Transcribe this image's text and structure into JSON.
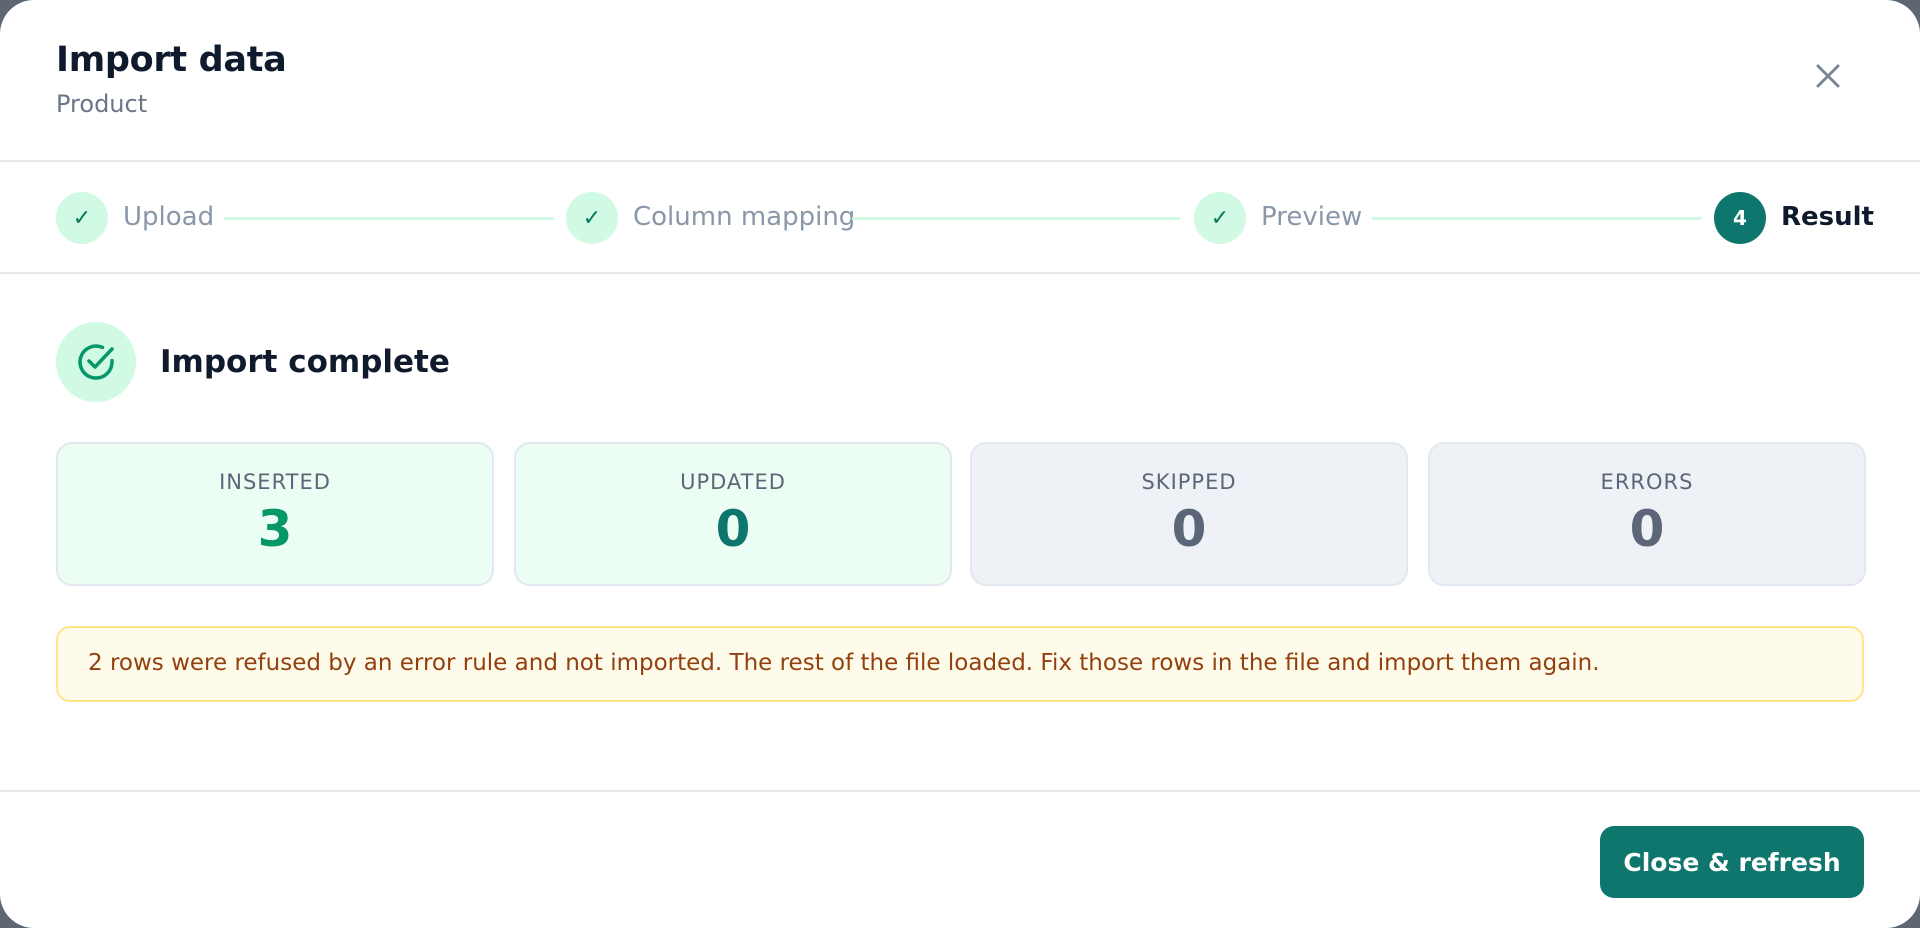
{
  "dialog": {
    "title": "Import data",
    "subtitle": "Product",
    "close_icon": "close-icon"
  },
  "steps": [
    {
      "label": "Upload",
      "state": "done",
      "marker": "✓"
    },
    {
      "label": "Column mapping",
      "state": "done",
      "marker": "✓"
    },
    {
      "label": "Preview",
      "state": "done",
      "marker": "✓"
    },
    {
      "label": "Result",
      "state": "active",
      "marker": "4"
    }
  ],
  "status": {
    "icon": "check-circle-icon",
    "text": "Import complete"
  },
  "stats": [
    {
      "label": "INSERTED",
      "value": "3",
      "color": "#059669"
    },
    {
      "label": "UPDATED",
      "value": "0",
      "color": "#0f766e"
    },
    {
      "label": "SKIPPED",
      "value": "0",
      "color": "#5b6779"
    },
    {
      "label": "ERRORS",
      "value": "0",
      "color": "#5b6779"
    }
  ],
  "notice": {
    "text": "2 rows were refused by an error rule and not imported. The rest of the file loaded. Fix those rows in the file and import them again."
  },
  "footer": {
    "close_refresh_label": "Close & refresh"
  },
  "colors": {
    "accent": "#0f766e",
    "success_bg": "#d1fae5",
    "warning_bg": "#fffbeb",
    "warning_text": "#92400e"
  }
}
